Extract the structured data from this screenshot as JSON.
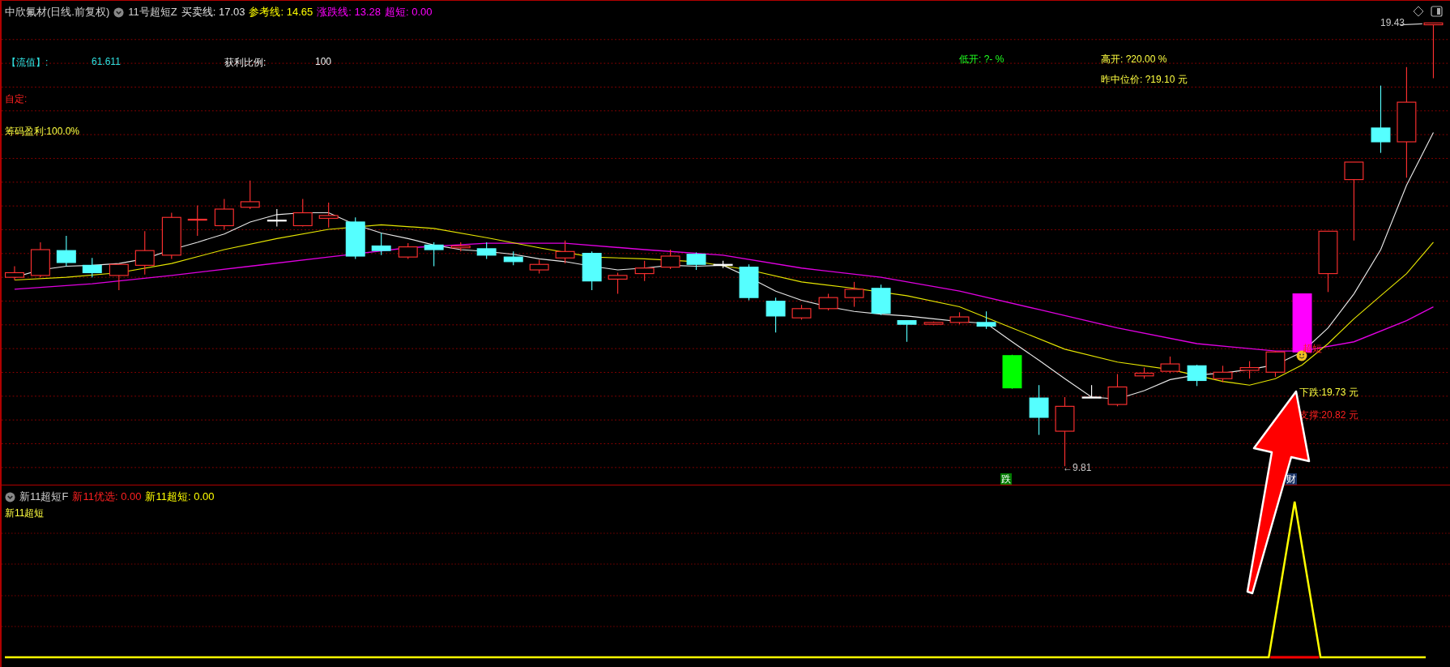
{
  "main_chart": {
    "stock": "中欣氟材(日线.前复权)",
    "indicator": "11号超短Z",
    "values": [
      {
        "label": "买卖线: 17.03",
        "color": "#e0e0e0"
      },
      {
        "label": "参考线: 14.65",
        "color": "#ffff00"
      },
      {
        "label": "涨跌线: 13.28",
        "color": "#ff00ff"
      },
      {
        "label": "超短: 0.00",
        "color": "#ff00ff"
      }
    ],
    "float_value": {
      "label": "【流值】:",
      "value": "61.611"
    },
    "profit_ratio": {
      "label": "获利比例:",
      "value": "100"
    },
    "custom": "自定:",
    "chip_profit": "筹码盈利:100.0%",
    "low_open": "低开: ?- %",
    "high_open": "高开: ?20.00 %",
    "prev_median": "昨中位价: ?19.10 元",
    "high_price": "19.43",
    "low_price": "←9.81",
    "signal": "超短",
    "fall": "下跌:19.73 元",
    "support": "支撑:20.82 元",
    "markers": [
      {
        "label": "跌",
        "color": "#007a00"
      },
      {
        "label": "财",
        "color": "#1a3466"
      }
    ]
  },
  "sub_chart": {
    "indicator": "新11超短F",
    "values": [
      {
        "label": "新11优选: 0.00",
        "color": "#ff2020"
      },
      {
        "label": "新11超短: 0.00",
        "color": "#ffff00"
      }
    ],
    "legend": "新11超短"
  }
}
